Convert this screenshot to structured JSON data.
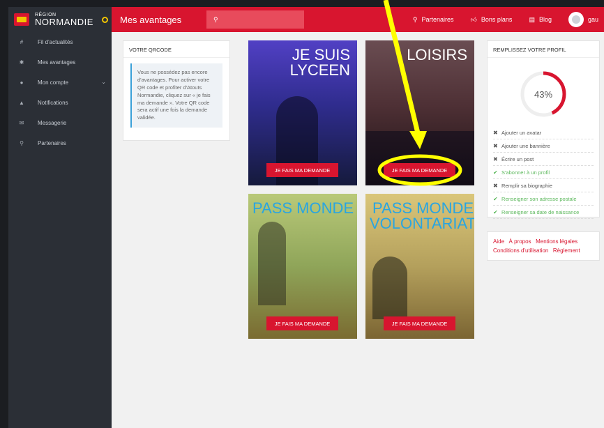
{
  "sidebar": {
    "brand_small": "RÉGION",
    "brand_big": "NORMANDIE",
    "items": [
      {
        "icon": "hash-icon",
        "label": "Fil d'actualités"
      },
      {
        "icon": "gift-icon",
        "label": "Mes avantages"
      },
      {
        "icon": "user-icon",
        "label": "Mon compte"
      },
      {
        "icon": "bell-icon",
        "label": "Notifications"
      },
      {
        "icon": "envelope-icon",
        "label": "Messagerie"
      },
      {
        "icon": "map-pin-icon",
        "label": "Partenaires"
      }
    ]
  },
  "topbar": {
    "title": "Mes avantages",
    "links": [
      "Partenaires",
      "Bons plans",
      "Blog"
    ],
    "user": "gau"
  },
  "qrcode": {
    "title": "VOTRE QRCODE",
    "text": "Vous ne possédez pas encore d'avantages. Pour activer votre QR code et profiter d'Atouts Normandie, cliquez sur « je fais ma demande ». Votre QR code sera actif une fois la demande validée."
  },
  "tiles": [
    {
      "title_line1": "JE SUIS",
      "title_line2": "LYCEEN",
      "button": "JE FAIS MA DEMANDE"
    },
    {
      "title_line1": "LOISIRS",
      "title_line2": "",
      "button": "JE FAIS MA DEMANDE"
    },
    {
      "title_line1": "PASS MONDE",
      "title_line2": "",
      "button": "JE FAIS MA DEMANDE"
    },
    {
      "title_line1": "PASS MONDE",
      "title_line2": "VOLONTARIAT",
      "button": "JE FAIS MA DEMANDE"
    }
  ],
  "profile": {
    "title": "REMPLISSEZ VOTRE PROFIL",
    "percent_label": "43%",
    "percent": 43,
    "items": [
      {
        "label": "Ajouter un avatar",
        "done": false
      },
      {
        "label": "Ajouter une bannière",
        "done": false
      },
      {
        "label": "Écrire un post",
        "done": false
      },
      {
        "label": "S'abonner à un profil",
        "done": true
      },
      {
        "label": "Remplir sa biographie",
        "done": false
      },
      {
        "label": "Renseigner son adresse postale",
        "done": true
      },
      {
        "label": "Renseigner sa date de naissance",
        "done": true
      }
    ]
  },
  "footer_links": [
    "Aide",
    "À propos",
    "Mentions légales",
    "Conditions d'utilisation",
    "Règlement"
  ],
  "colors": {
    "primary": "#d8152f",
    "accent": "#f2c500",
    "done": "#5cb85c",
    "sidebar": "#2b2f36",
    "annotation": "#ffff00"
  }
}
